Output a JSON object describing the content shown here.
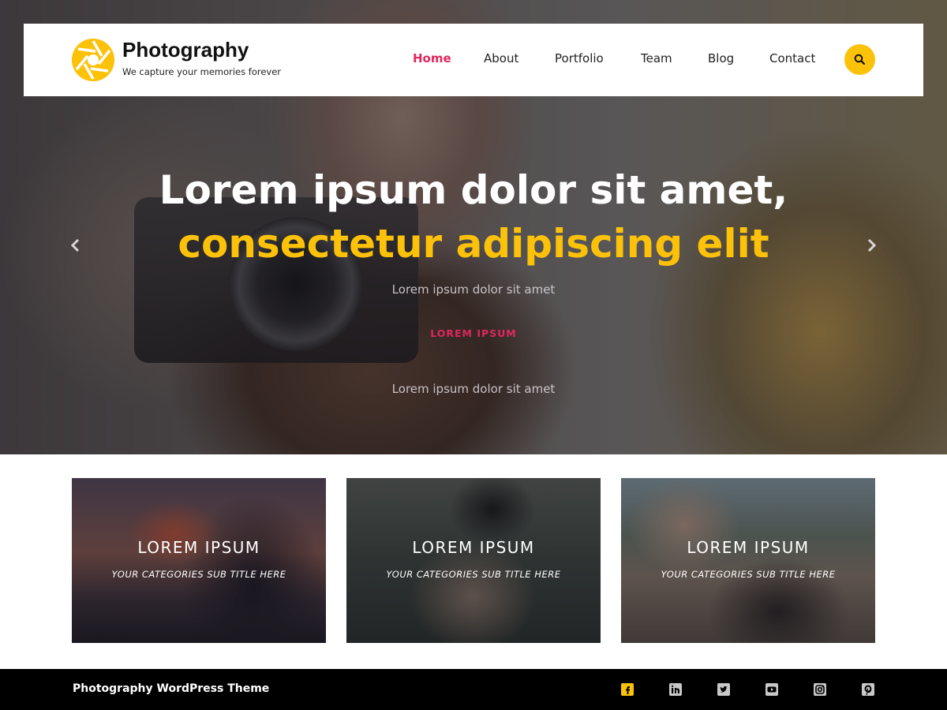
{
  "header": {
    "site_title": "Photography",
    "tagline": "We capture your memories forever",
    "nav": [
      {
        "label": "Home",
        "active": true
      },
      {
        "label": "About",
        "active": false
      },
      {
        "label": "Portfolio",
        "active": false
      },
      {
        "label": "Team",
        "active": false
      },
      {
        "label": "Blog",
        "active": false
      },
      {
        "label": "Contact",
        "active": false
      }
    ],
    "search_icon": "search-icon"
  },
  "hero": {
    "title_line1": "Lorem ipsum dolor sit amet,",
    "title_line2": "consectetur adipiscing elit",
    "subtitle1": "Lorem ipsum dolor sit amet",
    "button_label": "LOREM IPSUM",
    "subtitle2": "Lorem ipsum dolor sit amet",
    "prev_icon": "chevron-left-icon",
    "next_icon": "chevron-right-icon"
  },
  "categories": [
    {
      "title": "LOREM IPSUM",
      "subtitle": "YOUR CATEGORIES SUB TITLE HERE"
    },
    {
      "title": "LOREM IPSUM",
      "subtitle": "YOUR CATEGORIES SUB TITLE HERE"
    },
    {
      "title": "LOREM IPSUM",
      "subtitle": "YOUR CATEGORIES SUB TITLE HERE"
    }
  ],
  "footer": {
    "text": "Photography WordPress Theme",
    "social_icons": [
      "facebook-icon",
      "linkedin-icon",
      "twitter-icon",
      "youtube-icon",
      "instagram-icon",
      "pinterest-icon"
    ]
  },
  "colors": {
    "accent_yellow": "#fcc20a",
    "accent_pink": "#e0275e",
    "footer_bg": "#000000",
    "header_bg": "#ffffff"
  }
}
